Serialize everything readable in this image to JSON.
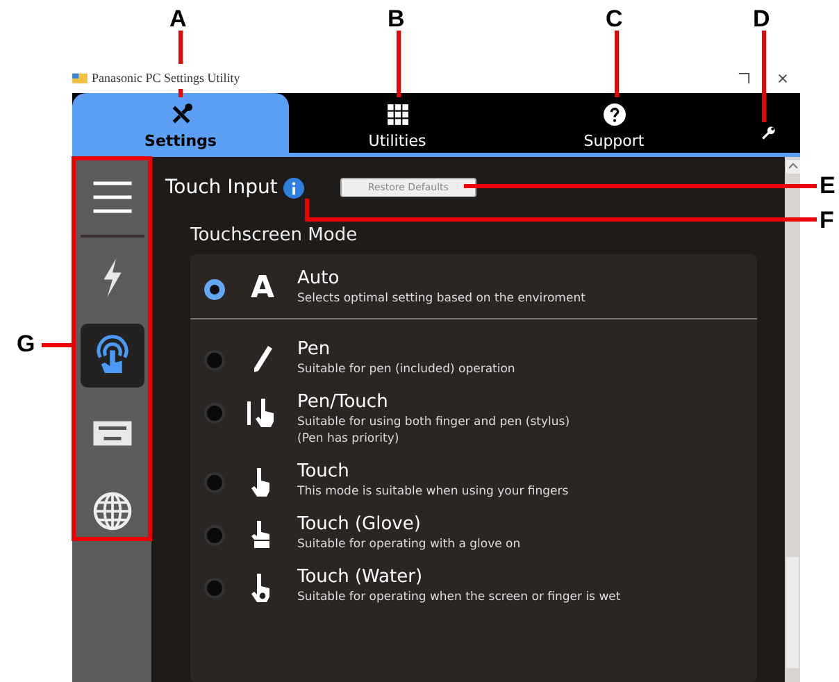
{
  "window": {
    "title": "Panasonic PC Settings Utility"
  },
  "tabs": [
    {
      "label": "Settings",
      "kind": "tools",
      "selected": true
    },
    {
      "label": "Utilities",
      "kind": "grid",
      "selected": false
    },
    {
      "label": "Support",
      "kind": "help",
      "selected": false
    }
  ],
  "sidebar": {
    "items": [
      {
        "kind": "menu",
        "selected": false
      },
      {
        "kind": "bolt",
        "selected": false
      },
      {
        "kind": "touch",
        "selected": true
      },
      {
        "kind": "keyboard",
        "selected": false
      },
      {
        "kind": "globe",
        "selected": false
      }
    ]
  },
  "content": {
    "heading": "Touch Input",
    "restore_button": "Restore Defaults",
    "section": "Touchscreen Mode",
    "modes": [
      {
        "icon_text": "A",
        "kind": "letter",
        "name": "Auto",
        "description": "Selects optimal setting based on the enviroment",
        "selected": true
      },
      {
        "kind": "pen",
        "name": "Pen",
        "description": "Suitable for pen (included) operation",
        "selected": false
      },
      {
        "kind": "pen-touch",
        "name": "Pen/Touch",
        "description": "Suitable for using both finger and pen (stylus)",
        "note": "(Pen has priority)",
        "selected": false
      },
      {
        "kind": "hand",
        "name": "Touch",
        "description": "This mode is suitable when using your fingers",
        "selected": false
      },
      {
        "kind": "glove",
        "name": "Touch (Glove)",
        "description": "Suitable for operating with a glove on",
        "selected": false
      },
      {
        "kind": "water",
        "name": "Touch (Water)",
        "description": "Suitable for operating when the screen or finger is wet",
        "selected": false
      }
    ]
  },
  "callouts": [
    {
      "label": "A"
    },
    {
      "label": "B"
    },
    {
      "label": "C"
    },
    {
      "label": "D"
    },
    {
      "label": "E"
    },
    {
      "label": "F"
    },
    {
      "label": "G"
    }
  ]
}
